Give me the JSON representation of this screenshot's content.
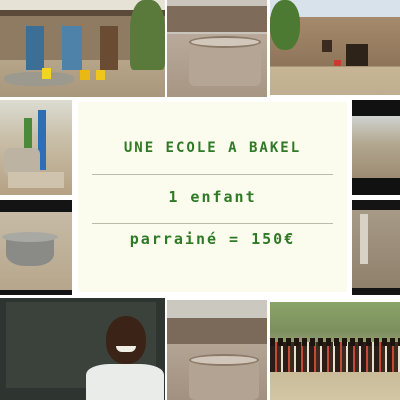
{
  "card": {
    "title": "UNE ECOLE A BAKEL",
    "line1": "1 enfant",
    "line2": "parrainé = 150€"
  },
  "colors": {
    "text": "#2f7a26",
    "card_background": "#fbfcee"
  }
}
